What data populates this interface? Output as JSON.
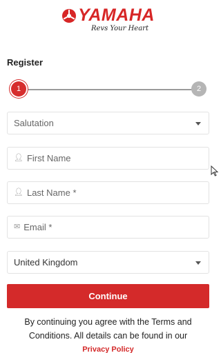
{
  "brand": {
    "name": "YAMAHA",
    "tagline": "Revs Your Heart",
    "color": "#d72626"
  },
  "form": {
    "title": "Register",
    "steps": [
      {
        "label": "1",
        "state": "active",
        "color": "#d62d2d"
      },
      {
        "label": "2",
        "state": "inactive",
        "color": "#b5b5b5"
      }
    ],
    "salutation": {
      "placeholder": "Salutation",
      "icon": "chevron-down-icon"
    },
    "first_name": {
      "placeholder": "First Name",
      "icon": "person-icon"
    },
    "last_name": {
      "placeholder": "Last Name *",
      "icon": "person-icon"
    },
    "email": {
      "placeholder": "Email *",
      "icon": "envelope-icon"
    },
    "country": {
      "value": "United Kingdom",
      "icon": "chevron-down-icon"
    },
    "continue_label": "Continue",
    "button_color": "#d42a2a"
  },
  "footer": {
    "terms_text": "By continuing you agree with the Terms and Conditions. All details can be found in our",
    "privacy_link": "Privacy Policy"
  }
}
